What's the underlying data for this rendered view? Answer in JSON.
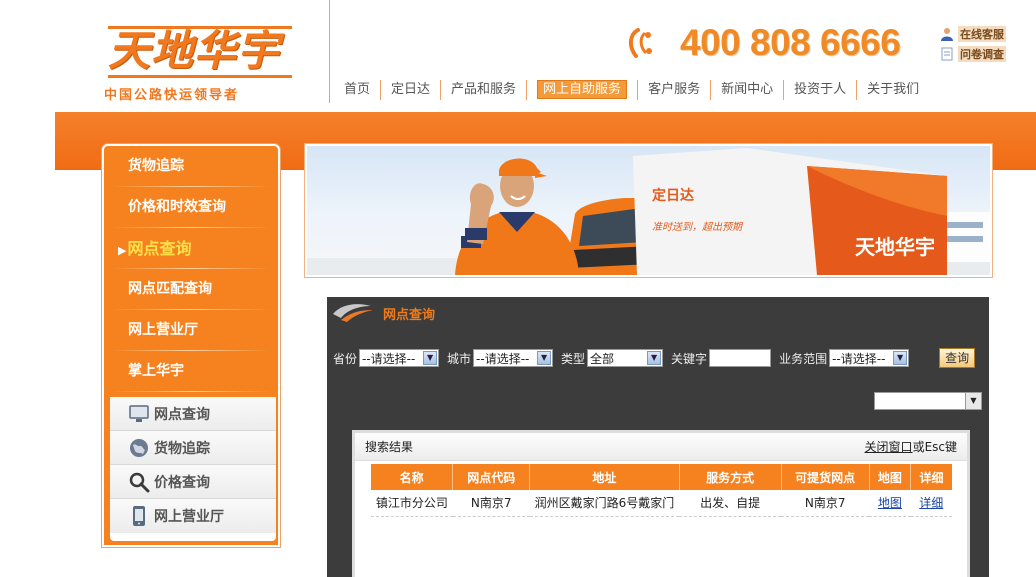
{
  "header": {
    "logo_text": "天地华宇",
    "slogan": "中国公路快运领导者",
    "hotline": "400 808 6666",
    "quicklinks": [
      {
        "label": "在线客服",
        "icon": "customer-service-icon"
      },
      {
        "label": "问卷调查",
        "icon": "survey-document-icon"
      }
    ],
    "nav": [
      {
        "label": "首页"
      },
      {
        "label": "定日达"
      },
      {
        "label": "产品和服务"
      },
      {
        "label": "网上自助服务",
        "active": true
      },
      {
        "label": "客户服务"
      },
      {
        "label": "新闻中心"
      },
      {
        "label": "投资于人"
      },
      {
        "label": "关于我们"
      }
    ]
  },
  "sidebar": {
    "items": [
      {
        "label": "货物追踪"
      },
      {
        "label": "价格和时效查询"
      },
      {
        "label": "网点查询",
        "active": true
      },
      {
        "label": "网点匹配查询"
      },
      {
        "label": "网上营业厅"
      },
      {
        "label": "掌上华宇"
      }
    ],
    "sub_items": [
      {
        "label": "网点查询",
        "icon": "monitor-icon"
      },
      {
        "label": "货物追踪",
        "icon": "globe-icon"
      },
      {
        "label": "价格查询",
        "icon": "magnifier-icon"
      },
      {
        "label": "网上营业厅",
        "icon": "mobile-phone-icon"
      }
    ]
  },
  "banner": {
    "truck_brand": "定日达",
    "truck_logo": "天地华宇",
    "truck_slogan": "准时送到，超出预期"
  },
  "panel": {
    "title": "网点查询",
    "filters": {
      "province_label": "省份",
      "province_value": "--请选择--",
      "city_label": "城市",
      "city_value": "--请选择--",
      "type_label": "类型",
      "type_value": "全部",
      "keyword_label": "关键字",
      "keyword_value": "",
      "scope_label": "业务范围",
      "scope_value": "--请选择--",
      "search_button": "查询"
    },
    "results": {
      "title": "搜索结果",
      "close_link": "关闭窗口",
      "close_suffix": "或Esc键",
      "columns": [
        "名称",
        "网点代码",
        "地址",
        "服务方式",
        "可提货网点",
        "地图",
        "详细"
      ],
      "rows": [
        {
          "name": "镇江市分公司",
          "code": "N南京7",
          "address": "润州区戴家门路6号戴家门",
          "service": "出发、自提",
          "pickup": "N南京7",
          "map": "地图",
          "detail": "详细"
        }
      ]
    }
  },
  "colors": {
    "brand_orange": "#f5821e",
    "panel_dark": "#3c3c3c",
    "link_blue": "#1a44a8"
  }
}
